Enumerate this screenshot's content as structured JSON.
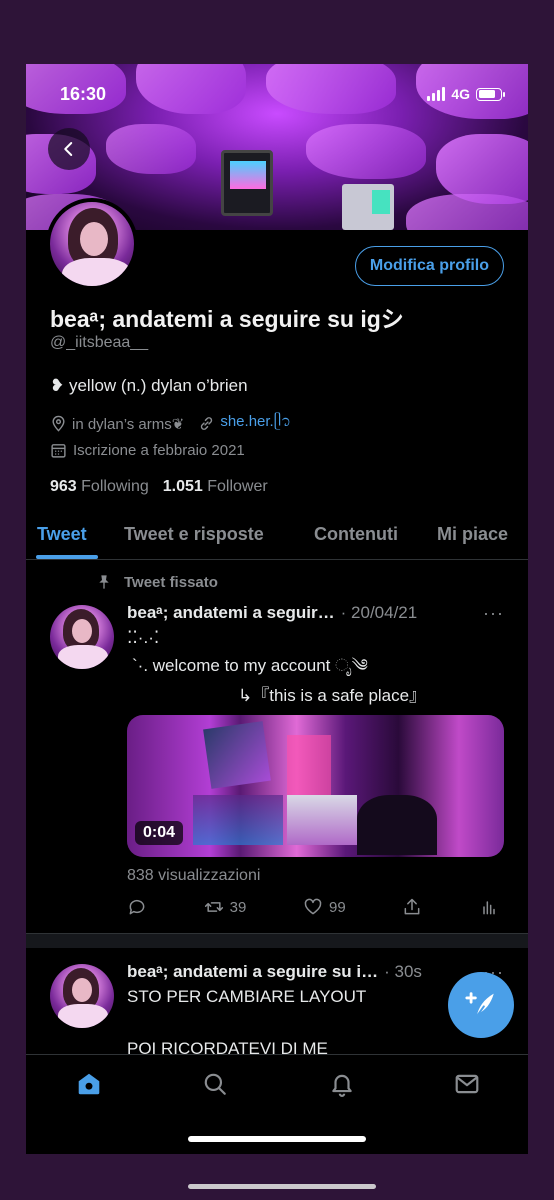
{
  "status_bar": {
    "time": "16:30",
    "network": "4G",
    "battery_level": 0.8
  },
  "profile": {
    "edit_button": "Modifica profilo",
    "name": "beaᵃ; andatemi a seguire su igシ",
    "handle": "@_iitsbeaa__",
    "bio": "❥ yellow (n.) dylan o’brien",
    "location": "in dylan’s arms❦",
    "link": "she.her.ᥫ᭡",
    "joined": "Iscrizione a febbraio 2021",
    "following_count": "963",
    "following_label": "Following",
    "followers_count": "1.051",
    "followers_label": "Follower"
  },
  "tabs": [
    "Tweet",
    "Tweet e risposte",
    "Contenuti",
    "Mi piace"
  ],
  "tweets": [
    {
      "pinned_label": "Tweet fissato",
      "name": "beaᵃ; andatemi a seguir…",
      "date": "· 20/04/21",
      "more": "···",
      "line1": "⁚⁚·.·⁚",
      "line2": "`·. welcome to my account ೃ༄",
      "line3": "↳『this is a safe place』",
      "duration": "0:04",
      "views": "838 visualizzazioni",
      "retweets": "39",
      "likes": "99"
    },
    {
      "name": "beaᵃ; andatemi a seguire su i…",
      "date": "· 30s",
      "more": "···",
      "line1": "STO PER CAMBIARE LAYOUT",
      "line2": "POI RICORDATEVI DI ME"
    }
  ],
  "icons": {
    "back": "chevron-left-icon",
    "location": "map-pin-icon",
    "link": "link-icon",
    "calendar": "calendar-icon",
    "pin": "pin-icon",
    "reply": "comment-icon",
    "retweet": "retweet-icon",
    "like": "heart-icon",
    "share": "share-icon",
    "analytics": "analytics-icon",
    "compose": "compose-feather-icon",
    "home": "home-icon",
    "search": "search-icon",
    "notifications": "bell-icon",
    "messages": "mail-icon"
  },
  "colors": {
    "accent": "#4a9fe8",
    "background": "#000000",
    "frame": "#2e1438",
    "secondary_text": "#8a8d91"
  }
}
